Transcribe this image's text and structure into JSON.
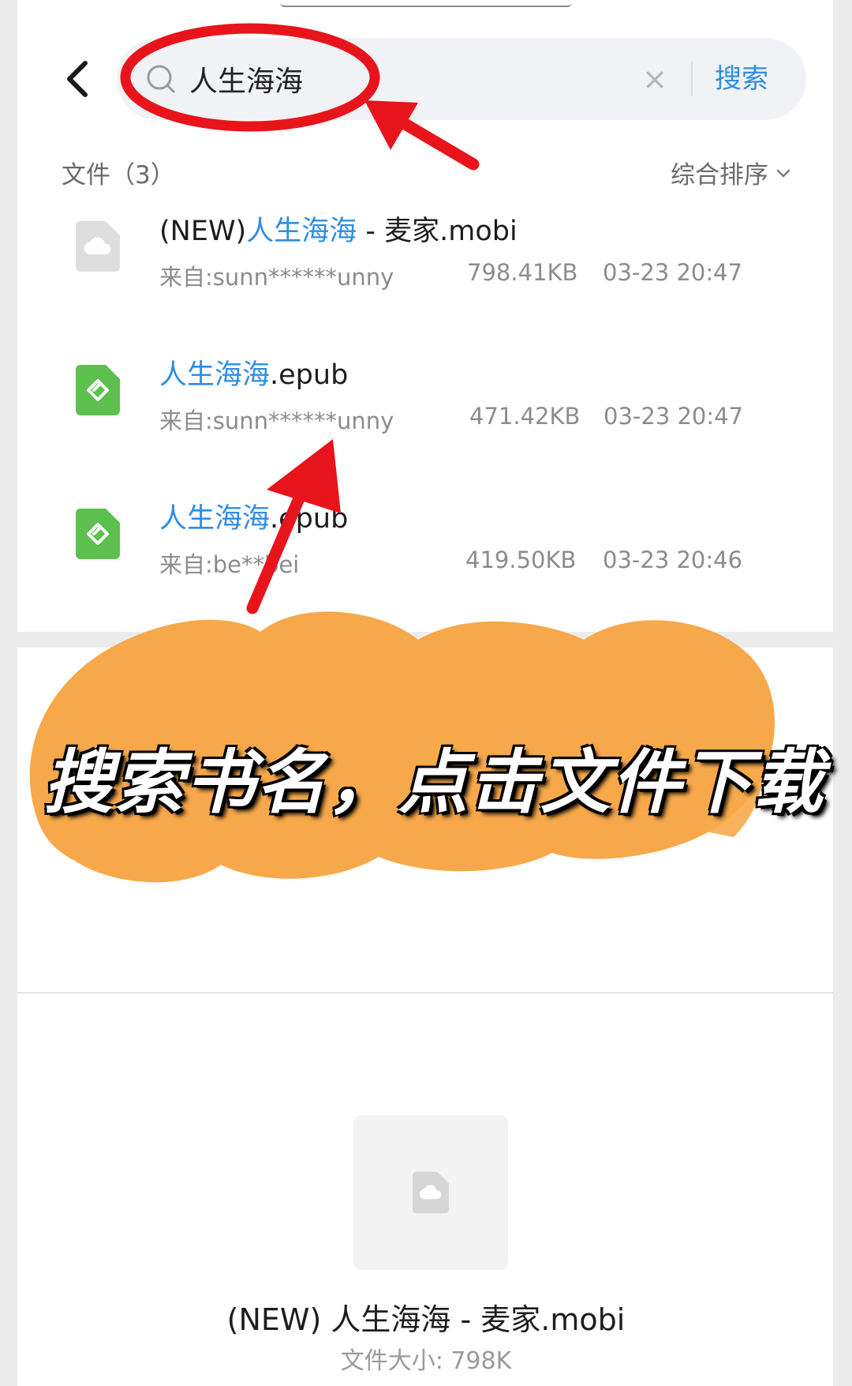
{
  "search": {
    "query": "人生海海",
    "clear_label": "×",
    "submit_label": "搜索"
  },
  "results_header": {
    "count_label": "文件（3）",
    "sort_label": "综合排序"
  },
  "files": [
    {
      "title_prefix": "(NEW)",
      "title_highlight": "人生海海",
      "title_suffix": " - 麦家.mobi",
      "source": "来自:sunn******unny",
      "size": "798.41KB",
      "time": "03-23 20:47",
      "icon": "cloud-doc-icon"
    },
    {
      "title_prefix": "",
      "title_highlight": "人生海海",
      "title_suffix": ".epub",
      "source": "来自:sunn******unny",
      "size": "471.42KB",
      "time": "03-23 20:47",
      "icon": "epub-icon"
    },
    {
      "title_prefix": "",
      "title_highlight": "人生海海",
      "title_suffix": ".epub",
      "source": "来自:be**bei",
      "size": "419.50KB",
      "time": "03-23 20:46",
      "icon": "epub-icon"
    }
  ],
  "annotation": {
    "banner_text": "搜索书名，点击文件下载",
    "circle_color": "#e8141c",
    "arrow_color": "#e8141c",
    "brush_color": "#f7a84a"
  },
  "preview": {
    "title": "(NEW) 人生海海 - 麦家.mobi",
    "size_label": "文件大小: 798K"
  },
  "colors": {
    "accent": "#2d8de4",
    "epub_green": "#5cbf4e"
  }
}
